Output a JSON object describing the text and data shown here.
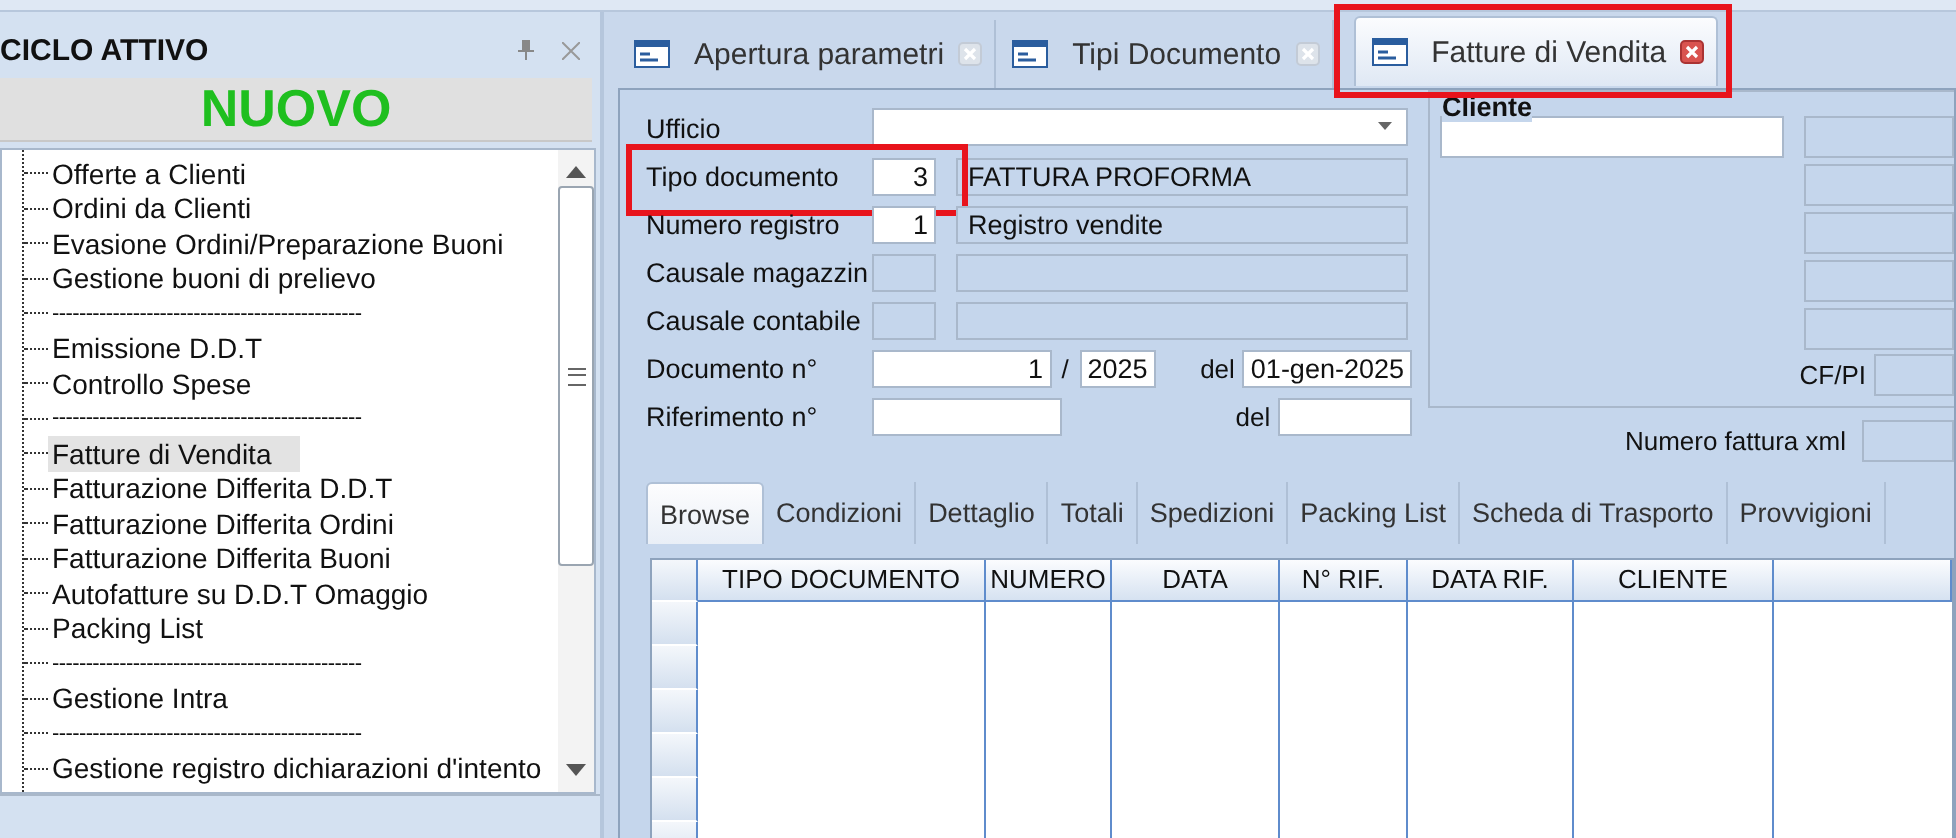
{
  "left_panel": {
    "title": "CICLO ATTIVO",
    "new_button": "NUOVO",
    "tree": [
      {
        "label": "Offerte a Clienti",
        "kind": "item",
        "selected": false
      },
      {
        "label": "Ordini da Clienti",
        "kind": "item",
        "selected": false
      },
      {
        "label": "Evasione Ordini/Preparazione Buoni",
        "kind": "item",
        "selected": false
      },
      {
        "label": "Gestione buoni di prelievo",
        "kind": "item",
        "selected": false
      },
      {
        "label": "----------------------------------------------",
        "kind": "separator"
      },
      {
        "label": "Emissione D.D.T",
        "kind": "item",
        "selected": false
      },
      {
        "label": "Controllo Spese",
        "kind": "item",
        "selected": false
      },
      {
        "label": "----------------------------------------------",
        "kind": "separator"
      },
      {
        "label": "Fatture di Vendita",
        "kind": "item",
        "selected": true
      },
      {
        "label": "Fatturazione Differita D.D.T",
        "kind": "item",
        "selected": false
      },
      {
        "label": "Fatturazione Differita  Ordini",
        "kind": "item",
        "selected": false
      },
      {
        "label": "Fatturazione Differita Buoni",
        "kind": "item",
        "selected": false
      },
      {
        "label": "Autofatture su D.D.T Omaggio",
        "kind": "item",
        "selected": false
      },
      {
        "label": "Packing List",
        "kind": "item",
        "selected": false
      },
      {
        "label": "----------------------------------------------",
        "kind": "separator"
      },
      {
        "label": "Gestione Intra",
        "kind": "item",
        "selected": false
      },
      {
        "label": "----------------------------------------------",
        "kind": "separator"
      },
      {
        "label": "Gestione registro dichiarazioni d'intento",
        "kind": "item",
        "selected": false
      }
    ]
  },
  "doc_tabs": [
    {
      "label": "Apertura parametri",
      "selected": false,
      "highlighted": false
    },
    {
      "label": "Tipi Documento",
      "selected": false,
      "highlighted": false
    },
    {
      "label": "Fatture di Vendita",
      "selected": true,
      "highlighted": true
    }
  ],
  "form": {
    "rows": [
      {
        "kind": "dropdown",
        "label": "Ufficio",
        "highlighted": false
      },
      {
        "kind": "code",
        "label": "Tipo documento",
        "code": "3",
        "description": "FATTURA PROFORMA",
        "highlighted": true
      },
      {
        "kind": "code",
        "label": "Numero registro",
        "code": "1",
        "description": "Registro vendite",
        "highlighted": false
      },
      {
        "kind": "code",
        "label": "Causale magazzin",
        "highlighted": false
      },
      {
        "kind": "code",
        "label": "Causale contabile",
        "highlighted": false
      },
      {
        "kind": "document",
        "label": "Documento n°",
        "number": "1",
        "slash": "/",
        "year": "2025",
        "date_label": "del",
        "date": "01-gen-2025",
        "highlighted": false
      },
      {
        "kind": "reference",
        "label": "Riferimento n°",
        "date_label": "del",
        "highlighted": false
      }
    ],
    "customer": {
      "title": "Cliente",
      "cf_label": "CF/PI"
    },
    "xml_label": "Numero fattura xml"
  },
  "sub_tabs": [
    {
      "label": "Browse",
      "selected": true
    },
    {
      "label": "Condizioni",
      "selected": false
    },
    {
      "label": "Dettaglio",
      "selected": false
    },
    {
      "label": "Totali",
      "selected": false
    },
    {
      "label": "Spedizioni",
      "selected": false
    },
    {
      "label": "Packing List",
      "selected": false
    },
    {
      "label": "Scheda di Trasporto",
      "selected": false
    },
    {
      "label": "Provvigioni",
      "selected": false
    }
  ],
  "grid": {
    "columns": [
      "TIPO DOCUMENTO",
      "NUMERO",
      "DATA",
      "N° RIF.",
      "DATA RIF.",
      "CLIENTE"
    ]
  }
}
